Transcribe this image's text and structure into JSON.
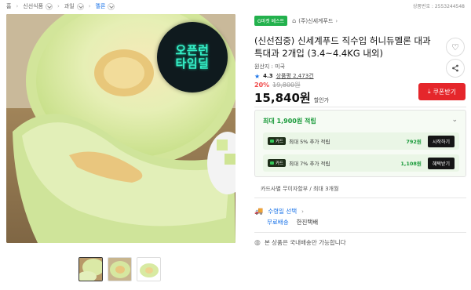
{
  "breadcrumb": [
    {
      "label": "홈",
      "has_dropdown": false
    },
    {
      "label": "신선식품",
      "has_dropdown": true
    },
    {
      "label": "과일",
      "has_dropdown": true
    },
    {
      "label": "멜론",
      "has_dropdown": true
    }
  ],
  "breadcrumb_sep": "›",
  "product_number": "상품번호 : 2553244548",
  "main_image": {
    "badge_line1": "오픈런",
    "badge_line2": "타임딜"
  },
  "thumbnails_count": 3,
  "tags": {
    "green_badge": "G마켓 베스트",
    "seller_icon": "home-icon",
    "seller_name": "(주)신세계푸드"
  },
  "title": "(신선집중) 신세계푸드 직수입 허니듀멜론 대과 특대과 2개입 (3.4~4.4KG 내외)",
  "origin": "원산지 : 미국",
  "rating": {
    "star": "★",
    "score": "4.3",
    "reviews": "상품평 2,473건"
  },
  "price": {
    "discount": "20%",
    "original": "19,800원",
    "sale": "15,840원",
    "sale_label": "할인가"
  },
  "coupon_button": "쿠폰받기",
  "points": {
    "headline_prefix": "최대",
    "headline_amount": "1,900원",
    "headline_suffix": "적립",
    "rows": [
      {
        "card": "카드",
        "desc": "최대 5% 추가 적립",
        "amount": "792원",
        "button": "시작하기"
      },
      {
        "card": "카드",
        "desc": "최대 7% 추가 적립",
        "amount": "1,108원",
        "button": "혜택받기"
      }
    ]
  },
  "installment": "카드사별 무이자할부 / 최대 3개월",
  "shipping": {
    "label": "수령일 선택",
    "free": "무료배송",
    "carrier": "한진택배"
  },
  "notice": "본 상품은 국내배송만 가능합니다",
  "colors": {
    "accent_blue": "#1a73e8",
    "sale_red": "#e5262b",
    "points_green": "#1a9a3a",
    "badge_mint": "#36f0c8"
  }
}
